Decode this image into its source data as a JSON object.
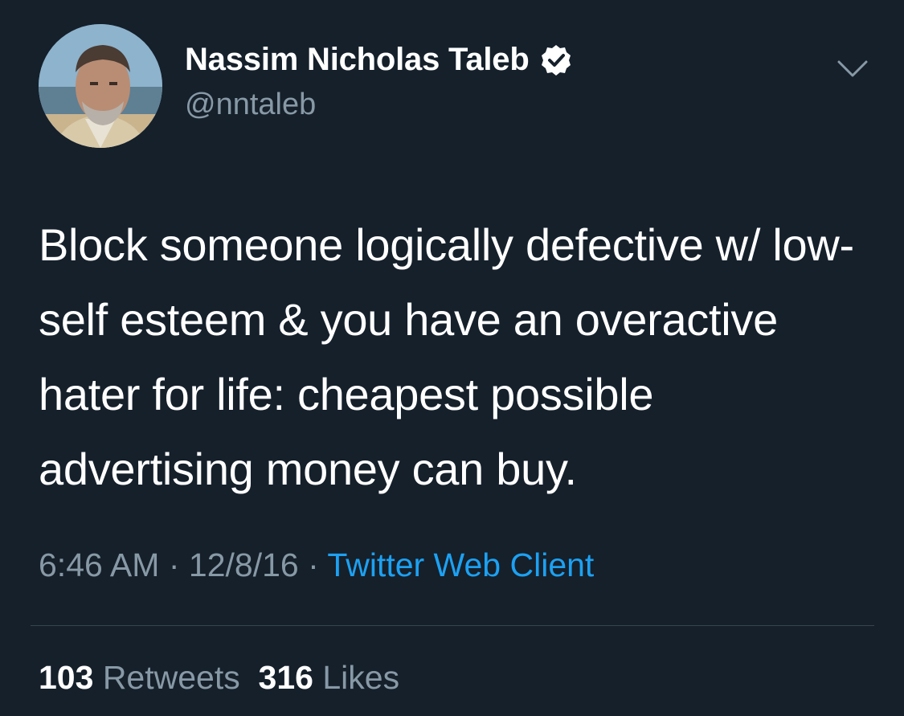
{
  "author": {
    "display_name": "Nassim Nicholas Taleb",
    "handle": "@nntaleb",
    "verified": true
  },
  "tweet": {
    "text": "Block someone logically defective w/ low-self esteem & you have an overactive hater for life: cheapest possible advertising money can buy.",
    "time": "6:46 AM",
    "date": "12/8/16",
    "separator": "·",
    "source": "Twitter Web Client"
  },
  "stats": {
    "retweets_count": "103",
    "retweets_label": "Retweets",
    "likes_count": "316",
    "likes_label": "Likes"
  },
  "icons": {
    "verified": "verified-badge-icon",
    "menu": "chevron-down-icon"
  },
  "colors": {
    "background": "#15202b",
    "primary_text": "#ffffff",
    "secondary_text": "#8899a6",
    "link": "#1da1f2",
    "divider": "#38444d"
  }
}
